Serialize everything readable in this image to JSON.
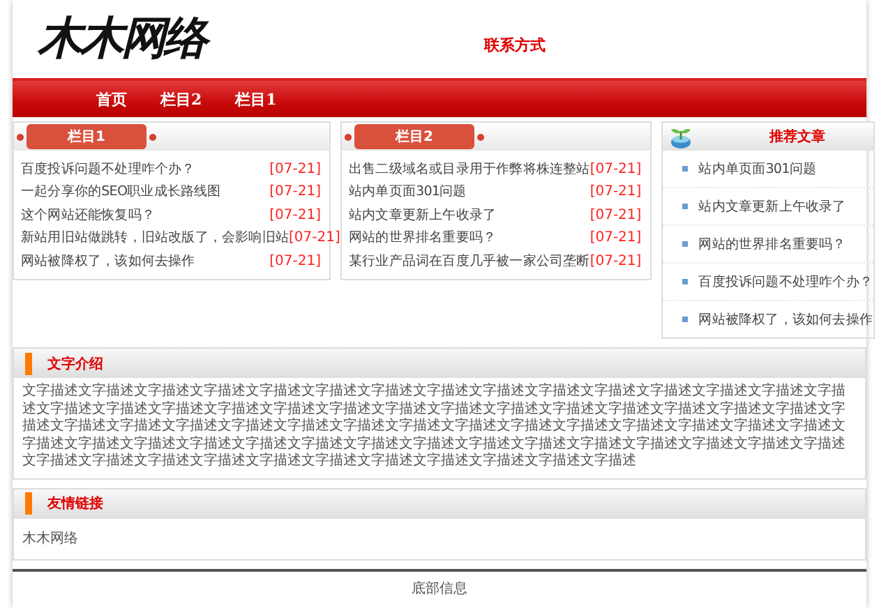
{
  "logo": "木木网络",
  "contact": "联系方式",
  "nav": [
    {
      "label": "首页"
    },
    {
      "label": "栏目2"
    },
    {
      "label": "栏目1"
    }
  ],
  "columns": [
    {
      "title": "栏目1",
      "items": [
        {
          "title": "百度投诉问题不处理咋个办？",
          "date": "[07-21]"
        },
        {
          "title": "一起分享你的SEO职业成长路线图",
          "date": "[07-21]"
        },
        {
          "title": "这个网站还能恢复吗？",
          "date": "[07-21]"
        },
        {
          "title": "新站用旧站做跳转，旧站改版了，会影响旧站",
          "date": "[07-21]"
        },
        {
          "title": "网站被降权了，该如何去操作",
          "date": "[07-21]"
        }
      ]
    },
    {
      "title": "栏目2",
      "items": [
        {
          "title": "出售二级域名或目录用于作弊将株连整站",
          "date": "[07-21]"
        },
        {
          "title": "站内单页面301问题",
          "date": "[07-21]"
        },
        {
          "title": "站内文章更新上午收录了",
          "date": "[07-21]"
        },
        {
          "title": "网站的世界排名重要吗？",
          "date": "[07-21]"
        },
        {
          "title": "某行业产品词在百度几乎被一家公司垄断",
          "date": "[07-21]"
        }
      ]
    }
  ],
  "recommended": {
    "title": "推荐文章",
    "items": [
      "站内单页面301问题",
      "站内文章更新上午收录了",
      "网站的世界排名重要吗？",
      "百度投诉问题不处理咋个办？",
      "网站被降权了，该如何去操作"
    ]
  },
  "intro": {
    "title": "文字介绍",
    "text": "文字描述文字描述文字描述文字描述文字描述文字描述文字描述文字描述文字描述文字描述文字描述文字描述文字描述文字描述文字描述文字描述文字描述文字描述文字描述文字描述文字描述文字描述文字描述文字描述文字描述文字描述文字描述文字描述文字描述文字描述文字描述文字描述文字描述文字描述文字描述文字描述文字描述文字描述文字描述文字描述文字描述文字描述文字描述文字描述文字描述文字描述文字描述文字描述文字描述文字描述文字描述文字描述文字描述文字描述文字描述文字描述文字描述文字描述文字描述文字描述文字描述文字描述文字描述文字描述文字描述文字描述文字描述文字描述文字描述文字描述"
  },
  "links": {
    "title": "友情链接",
    "items": [
      "木木网络"
    ]
  },
  "footer": "底部信息"
}
